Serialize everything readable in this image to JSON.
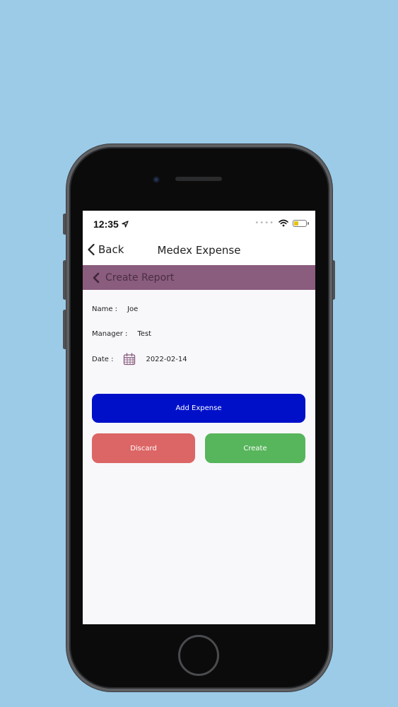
{
  "status_bar": {
    "time": "12:35",
    "location_icon": "location-arrow-icon",
    "wifi_icon": "wifi-icon",
    "battery_icon": "battery-charging-icon",
    "battery_level_percent": 40
  },
  "nav": {
    "back_label": "Back",
    "title": "Medex Expense"
  },
  "section": {
    "title": "Create Report"
  },
  "form": {
    "name_label": "Name :",
    "name_value": "Joe",
    "manager_label": "Manager :",
    "manager_value": "Test",
    "date_label": "Date :",
    "date_value": "2022-02-14",
    "date_icon": "calendar-icon"
  },
  "buttons": {
    "add_expense": "Add Expense",
    "discard": "Discard",
    "create": "Create"
  },
  "colors": {
    "background": "#9ccbe8",
    "section_header": "#8a5c7d",
    "add_button": "#0010c9",
    "discard_button": "#dc6565",
    "create_button": "#57b55b"
  }
}
